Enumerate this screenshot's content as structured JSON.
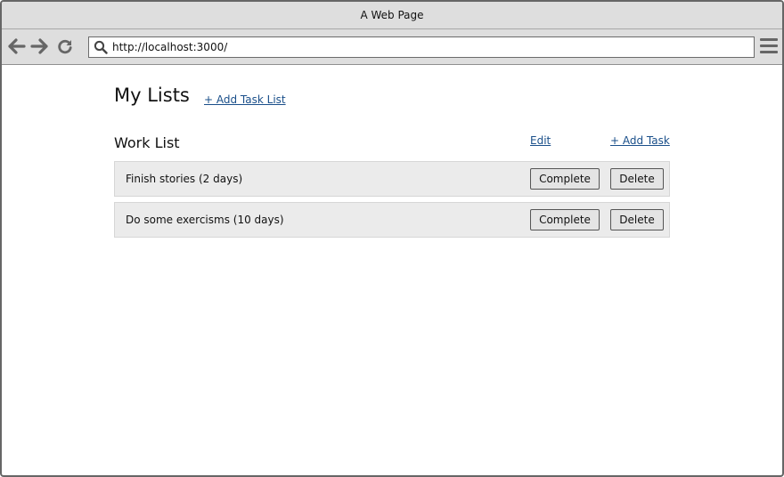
{
  "window": {
    "title": "A Web Page"
  },
  "browser": {
    "url": "http://localhost:3000/",
    "icons": {
      "back": "arrow-left-icon",
      "forward": "arrow-right-icon",
      "reload": "reload-icon",
      "search": "search-icon",
      "menu": "hamburger-menu-icon"
    }
  },
  "page": {
    "title": "My Lists",
    "add_list_label": "+ Add Task List",
    "list": {
      "name": "Work List",
      "edit_label": "Edit",
      "add_task_label": "+ Add Task",
      "tasks": [
        {
          "label": "Finish stories (2 days)",
          "complete_label": "Complete",
          "delete_label": "Delete"
        },
        {
          "label": "Do some exercisms (10 days)",
          "complete_label": "Complete",
          "delete_label": "Delete"
        }
      ]
    }
  },
  "colors": {
    "link": "#1a4f8a",
    "row_bg": "#ebebeb",
    "chrome_bg": "#dedede"
  }
}
